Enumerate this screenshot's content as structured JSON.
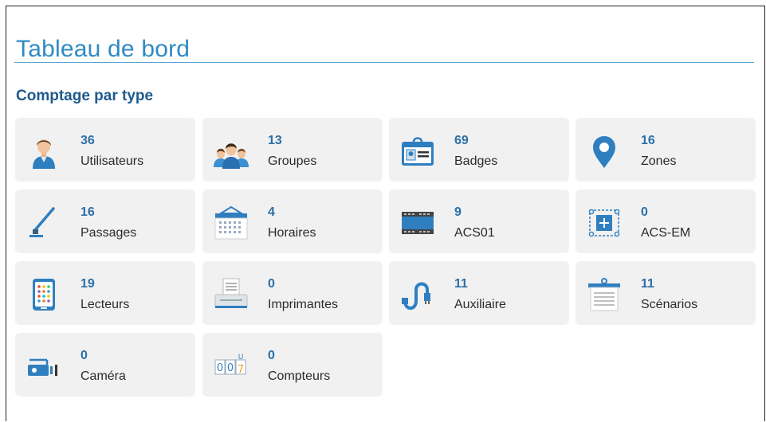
{
  "page": {
    "title": "Tableau de bord"
  },
  "section": {
    "title": "Comptage par type"
  },
  "tiles": [
    {
      "count": "36",
      "label": "Utilisateurs",
      "icon": "user-icon"
    },
    {
      "count": "13",
      "label": "Groupes",
      "icon": "group-icon"
    },
    {
      "count": "69",
      "label": "Badges",
      "icon": "badge-icon"
    },
    {
      "count": "16",
      "label": "Zones",
      "icon": "location-pin-icon"
    },
    {
      "count": "16",
      "label": "Passages",
      "icon": "barrier-gate-icon"
    },
    {
      "count": "4",
      "label": "Horaires",
      "icon": "calendar-icon"
    },
    {
      "count": "9",
      "label": "ACS01",
      "icon": "controller-module-icon"
    },
    {
      "count": "0",
      "label": "ACS-EM",
      "icon": "expansion-module-icon"
    },
    {
      "count": "19",
      "label": "Lecteurs",
      "icon": "reader-keypad-icon"
    },
    {
      "count": "0",
      "label": "Imprimantes",
      "icon": "printer-icon"
    },
    {
      "count": "11",
      "label": "Auxiliaire",
      "icon": "auxiliary-connector-icon"
    },
    {
      "count": "11",
      "label": "Scénarios",
      "icon": "scenario-clipboard-icon"
    },
    {
      "count": "0",
      "label": "Caméra",
      "icon": "camera-icon"
    },
    {
      "count": "0",
      "label": "Compteurs",
      "icon": "counter-icon"
    }
  ],
  "colors": {
    "title": "#2f8ac4",
    "section": "#1e5b8e",
    "count": "#2c6fa8",
    "tile_bg": "#f1f1f1"
  }
}
